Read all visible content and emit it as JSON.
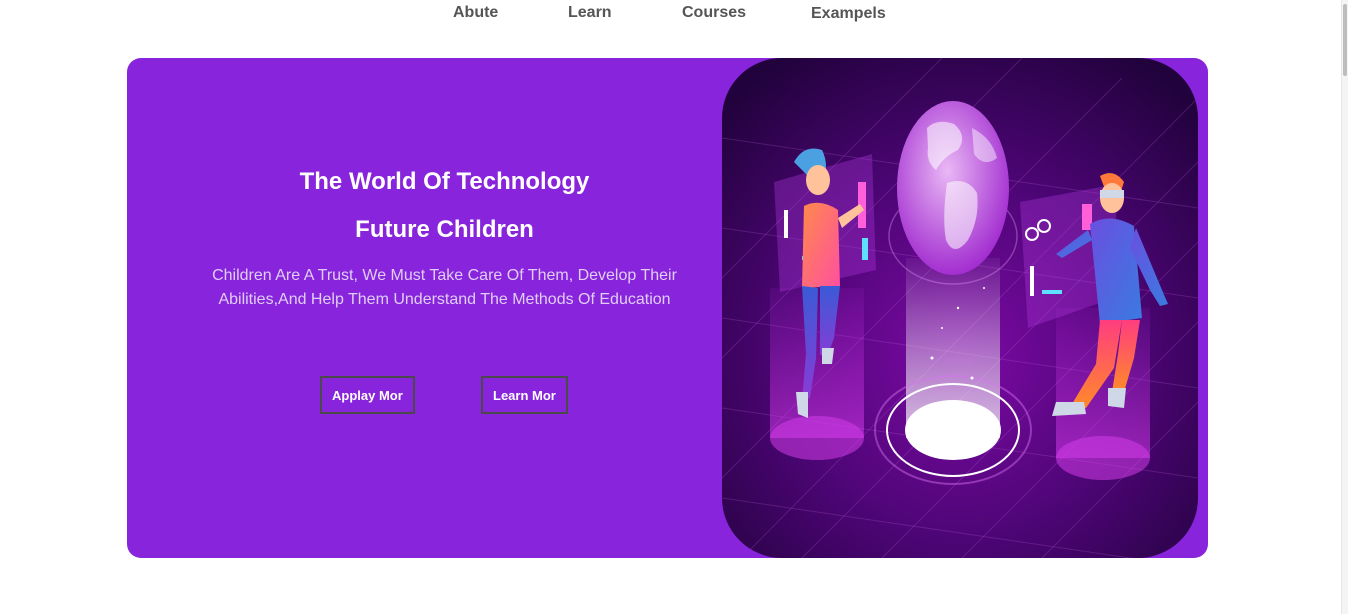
{
  "nav": {
    "items": [
      "Abute",
      "Learn",
      "Courses",
      "Exampels"
    ]
  },
  "hero": {
    "title": "The World Of Technology",
    "subtitle": "Future Children",
    "description": "Children Are A Trust, We Must Take Care Of Them, Develop Their Abilities,And Help Them Understand The Methods Of Education",
    "buttons": {
      "apply": "Applay Mor",
      "learn": "Learn Mor"
    }
  },
  "colors": {
    "hero_background": "#8724dc",
    "nav_text": "#555555",
    "button_border": "#4a4a4a"
  },
  "icons": {
    "illustration": "children-technology-illustration"
  }
}
